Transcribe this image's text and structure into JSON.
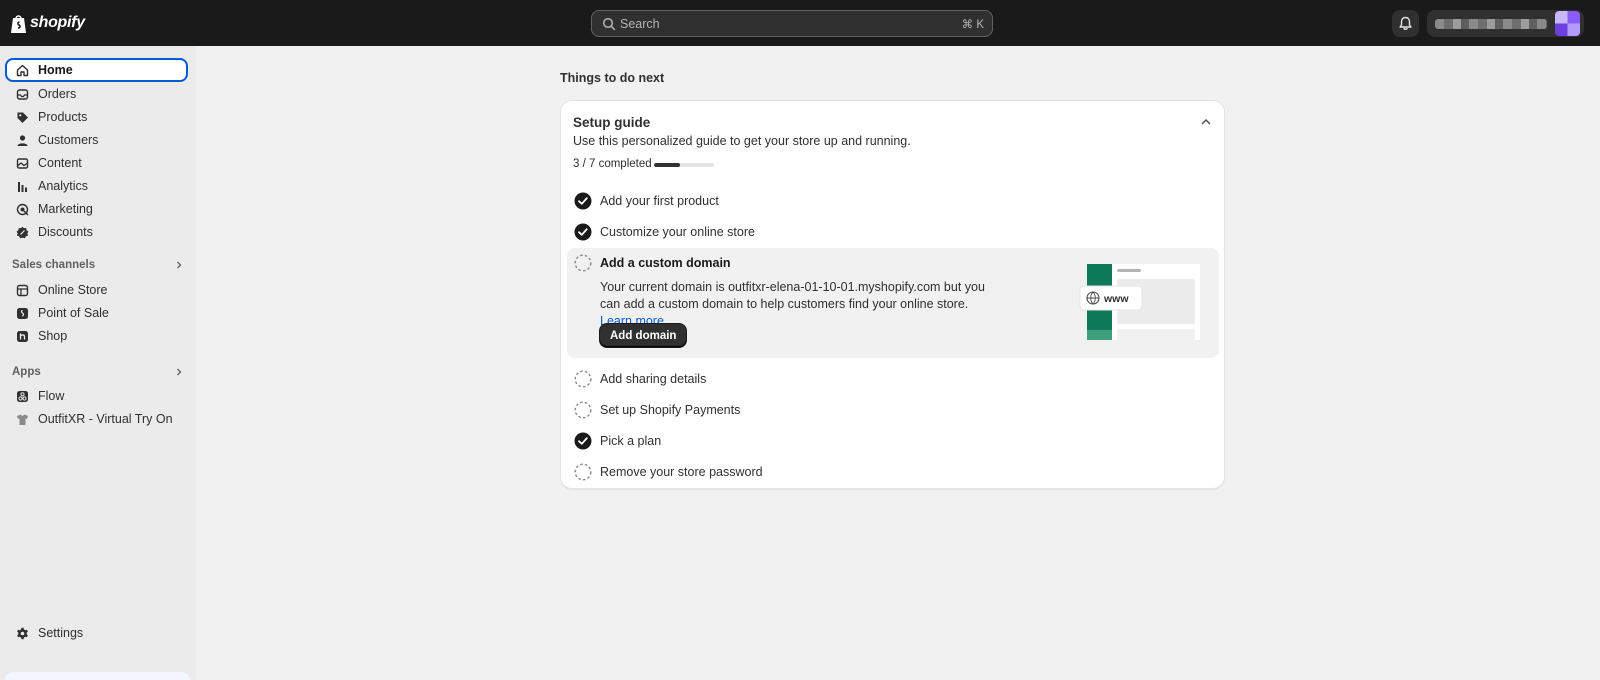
{
  "topbar": {
    "logo_text": "shopify",
    "search_placeholder": "Search",
    "search_shortcut": "⌘ K",
    "icons": [
      "shopify-bag-icon",
      "search-icon",
      "bell-icon"
    ]
  },
  "sidebar": {
    "items": [
      {
        "label": "Home",
        "icon": "home-icon",
        "active": true
      },
      {
        "label": "Orders",
        "icon": "inbox-icon"
      },
      {
        "label": "Products",
        "icon": "tag-icon"
      },
      {
        "label": "Customers",
        "icon": "person-icon"
      },
      {
        "label": "Content",
        "icon": "image-icon"
      },
      {
        "label": "Analytics",
        "icon": "bar-chart-icon"
      },
      {
        "label": "Marketing",
        "icon": "target-icon"
      },
      {
        "label": "Discounts",
        "icon": "discount-icon"
      }
    ],
    "sales_channels_heading": "Sales channels",
    "sales_channels": [
      {
        "label": "Online Store",
        "icon": "store-icon"
      },
      {
        "label": "Point of Sale",
        "icon": "pos-icon"
      },
      {
        "label": "Shop",
        "icon": "shop-icon"
      }
    ],
    "apps_heading": "Apps",
    "apps": [
      {
        "label": "Flow",
        "icon": "flow-icon"
      },
      {
        "label": "OutfitXR - Virtual Try On",
        "icon": "outfitxr-icon"
      }
    ],
    "settings": {
      "label": "Settings",
      "icon": "gear-icon"
    }
  },
  "main": {
    "section_title": "Things to do next",
    "guide": {
      "title": "Setup guide",
      "subtitle": "Use this personalized guide to get your store up and running.",
      "progress_text": "3 / 7 completed",
      "progress_fraction": 0.43,
      "tasks": [
        {
          "label": "Add your first product",
          "done": true
        },
        {
          "label": "Customize your online store",
          "done": true
        },
        {
          "label": "Add a custom domain",
          "done": false,
          "expanded": true,
          "description": "Your current domain is outfitxr-elena-01-10-01.myshopify.com but you can add a custom domain to help customers find your online store.",
          "link": "Learn more",
          "button": "Add domain",
          "illustration_text": "www"
        },
        {
          "label": "Add sharing details",
          "done": false
        },
        {
          "label": "Set up Shopify Payments",
          "done": false
        },
        {
          "label": "Pick a plan",
          "done": true
        },
        {
          "label": "Remove your store password",
          "done": false
        }
      ]
    }
  }
}
